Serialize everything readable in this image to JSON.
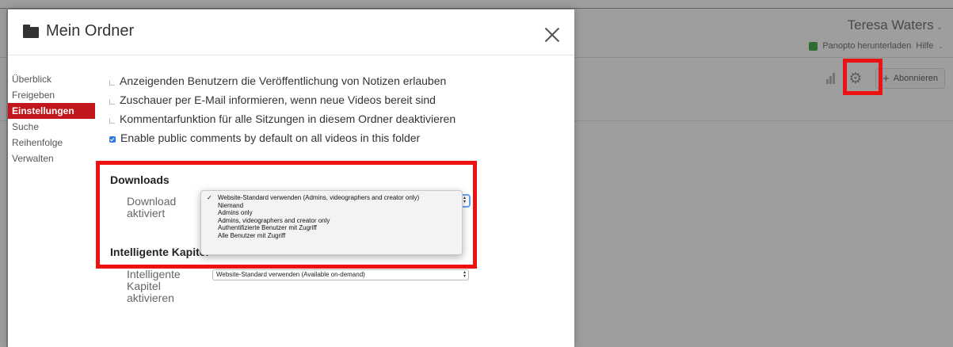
{
  "background": {
    "user_name": "Teresa Waters",
    "download_link": "Panopto herunterladen",
    "help_link": "Hilfe",
    "subscribe_label": "Abonnieren"
  },
  "modal": {
    "title": "Mein Ordner",
    "nav": [
      {
        "label": "Überblick",
        "active": false
      },
      {
        "label": "Freigeben",
        "active": false
      },
      {
        "label": "Einstellungen",
        "active": true
      },
      {
        "label": "Suche",
        "active": false
      },
      {
        "label": "Reihenfolge",
        "active": false
      },
      {
        "label": "Verwalten",
        "active": false
      }
    ],
    "checkboxes": [
      {
        "label": "Anzeigenden Benutzern die Veröffentlichung von Notizen erlauben",
        "checked": false
      },
      {
        "label": "Zuschauer per E-Mail informieren, wenn neue Videos bereit sind",
        "checked": false
      },
      {
        "label": "Kommentarfunktion für alle Sitzungen in diesem Ordner deaktivieren",
        "checked": false
      },
      {
        "label": "Enable public comments by default on all videos in this folder",
        "checked": true
      }
    ],
    "downloads": {
      "heading": "Downloads",
      "field_label_line1": "Download",
      "field_label_line2": "aktiviert",
      "options": [
        "Website-Standard verwenden (Admins, videographers and creator only)",
        "Niemand",
        "Admins only",
        "Admins, videographers and creator only",
        "Authentifizierte Benutzer mit Zugriff",
        "Alle Benutzer mit Zugriff"
      ],
      "selected_index": 0
    },
    "smart_chapters": {
      "heading": "Intelligente Kapitel",
      "field_label_line1": "Intelligente",
      "field_label_line2": "Kapitel",
      "field_label_line3": "aktivieren",
      "selected_value": "Website-Standard verwenden (Available on-demand)"
    }
  },
  "colors": {
    "active_nav": "#c3161c",
    "highlight": "#ee1111",
    "checkbox_checked": "#2f78e0"
  },
  "icons": {
    "folder": "folder-icon",
    "close": "close-icon",
    "gear": "gear-icon",
    "stats": "bar-chart-icon",
    "download": "download-icon",
    "plus": "plus-icon",
    "check": "checkmark-icon"
  }
}
